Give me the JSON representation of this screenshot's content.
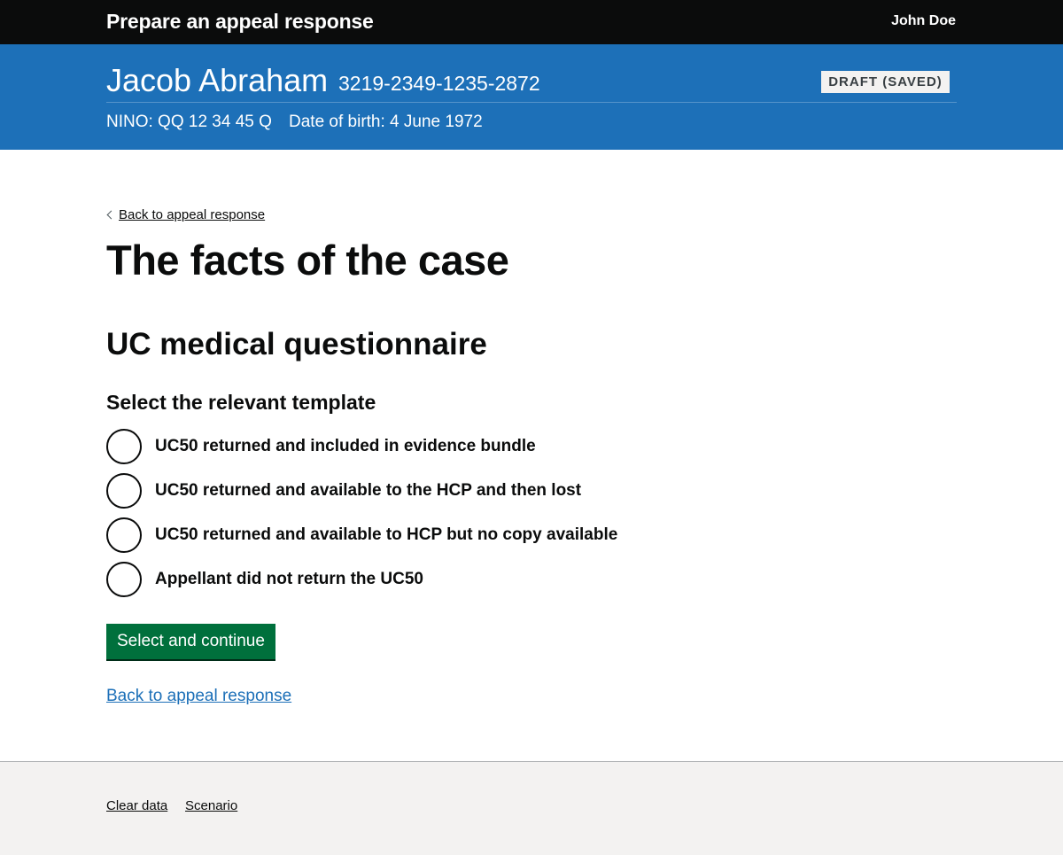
{
  "header": {
    "service_name": "Prepare an appeal response",
    "user_name": "John Doe"
  },
  "case": {
    "appellant_name": "Jacob Abraham",
    "reference": "3219-2349-1235-2872",
    "status": "DRAFT (SAVED)",
    "nino": "NINO: QQ 12 34 45 Q",
    "date_of_birth": "Date of birth: 4 June 1972"
  },
  "main": {
    "back_link_top": "Back to appeal response",
    "page_title": "The facts of the case",
    "section_title": "UC medical questionnaire",
    "legend": "Select the relevant template",
    "options": [
      "UC50 returned and included in evidence bundle",
      "UC50 returned and available to the HCP and then lost",
      "UC50 returned and available to HCP but no copy available",
      "Appellant did not return the UC50"
    ],
    "submit_label": "Select and continue",
    "back_link_bottom": "Back to appeal response"
  },
  "footer": {
    "links": [
      "Clear data",
      "Scenario"
    ]
  },
  "colors": {
    "header_bg": "#0b0c0c",
    "banner_bg": "#1d70b8",
    "button_bg": "#00703c",
    "link": "#1d70b8",
    "footer_bg": "#f3f2f1"
  }
}
